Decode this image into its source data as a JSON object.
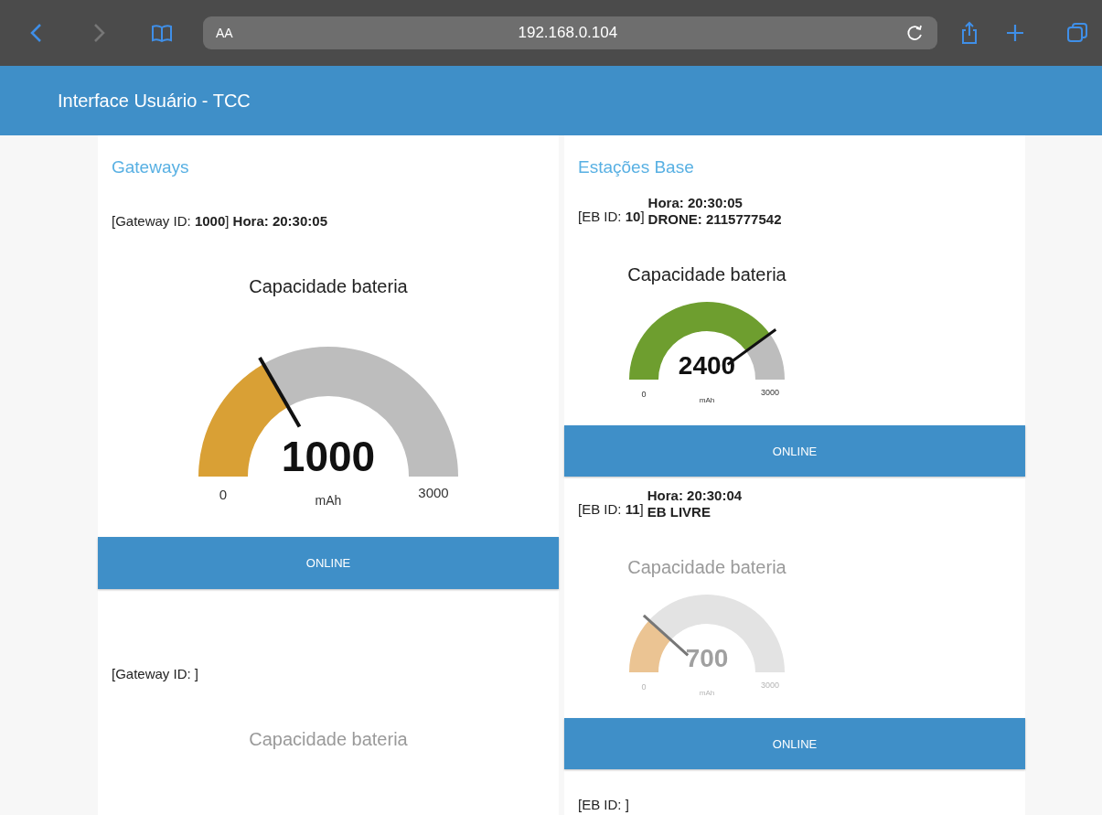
{
  "browser": {
    "text_size_button": "AA",
    "url": "192.168.0.104"
  },
  "header": {
    "title": "Interface Usuário - TCC"
  },
  "columns": [
    {
      "kind": "gateways",
      "title": "Gateways",
      "units": [
        {
          "info": "[Gateway ID: **1000**] **Hora: 20:30:05**",
          "gauge": {
            "title": "Capacidade bateria",
            "value": "1000",
            "min": "0",
            "max": "3000",
            "unit": "mAh",
            "color": "#d9a035",
            "disabled": false
          },
          "button": "ONLINE"
        },
        {
          "info": "[Gateway ID: ]",
          "gauge": {
            "title": "Capacidade bateria",
            "disabled": true
          }
        }
      ]
    },
    {
      "kind": "stations",
      "title": "Estações Base",
      "units": [
        {
          "id_label": "[EB ID: **10**]",
          "lines": [
            "Hora: 20:30:05",
            "DRONE: 2115777542"
          ],
          "gauge": {
            "title": "Capacidade bateria",
            "value": "2400",
            "min": "0",
            "max": "3000",
            "unit": "mAh",
            "color": "#6e9e2f",
            "disabled": false
          },
          "button": "ONLINE"
        },
        {
          "id_label": "[EB ID: **11**]",
          "lines": [
            "Hora: 20:30:04",
            "EB LIVRE"
          ],
          "gauge": {
            "title": "Capacidade bateria",
            "value": "700",
            "min": "0",
            "max": "3000",
            "unit": "mAh",
            "color": "#ebc493",
            "disabled": true
          },
          "button": "ONLINE"
        },
        {
          "id_label": "[EB ID: ]"
        }
      ]
    }
  ]
}
